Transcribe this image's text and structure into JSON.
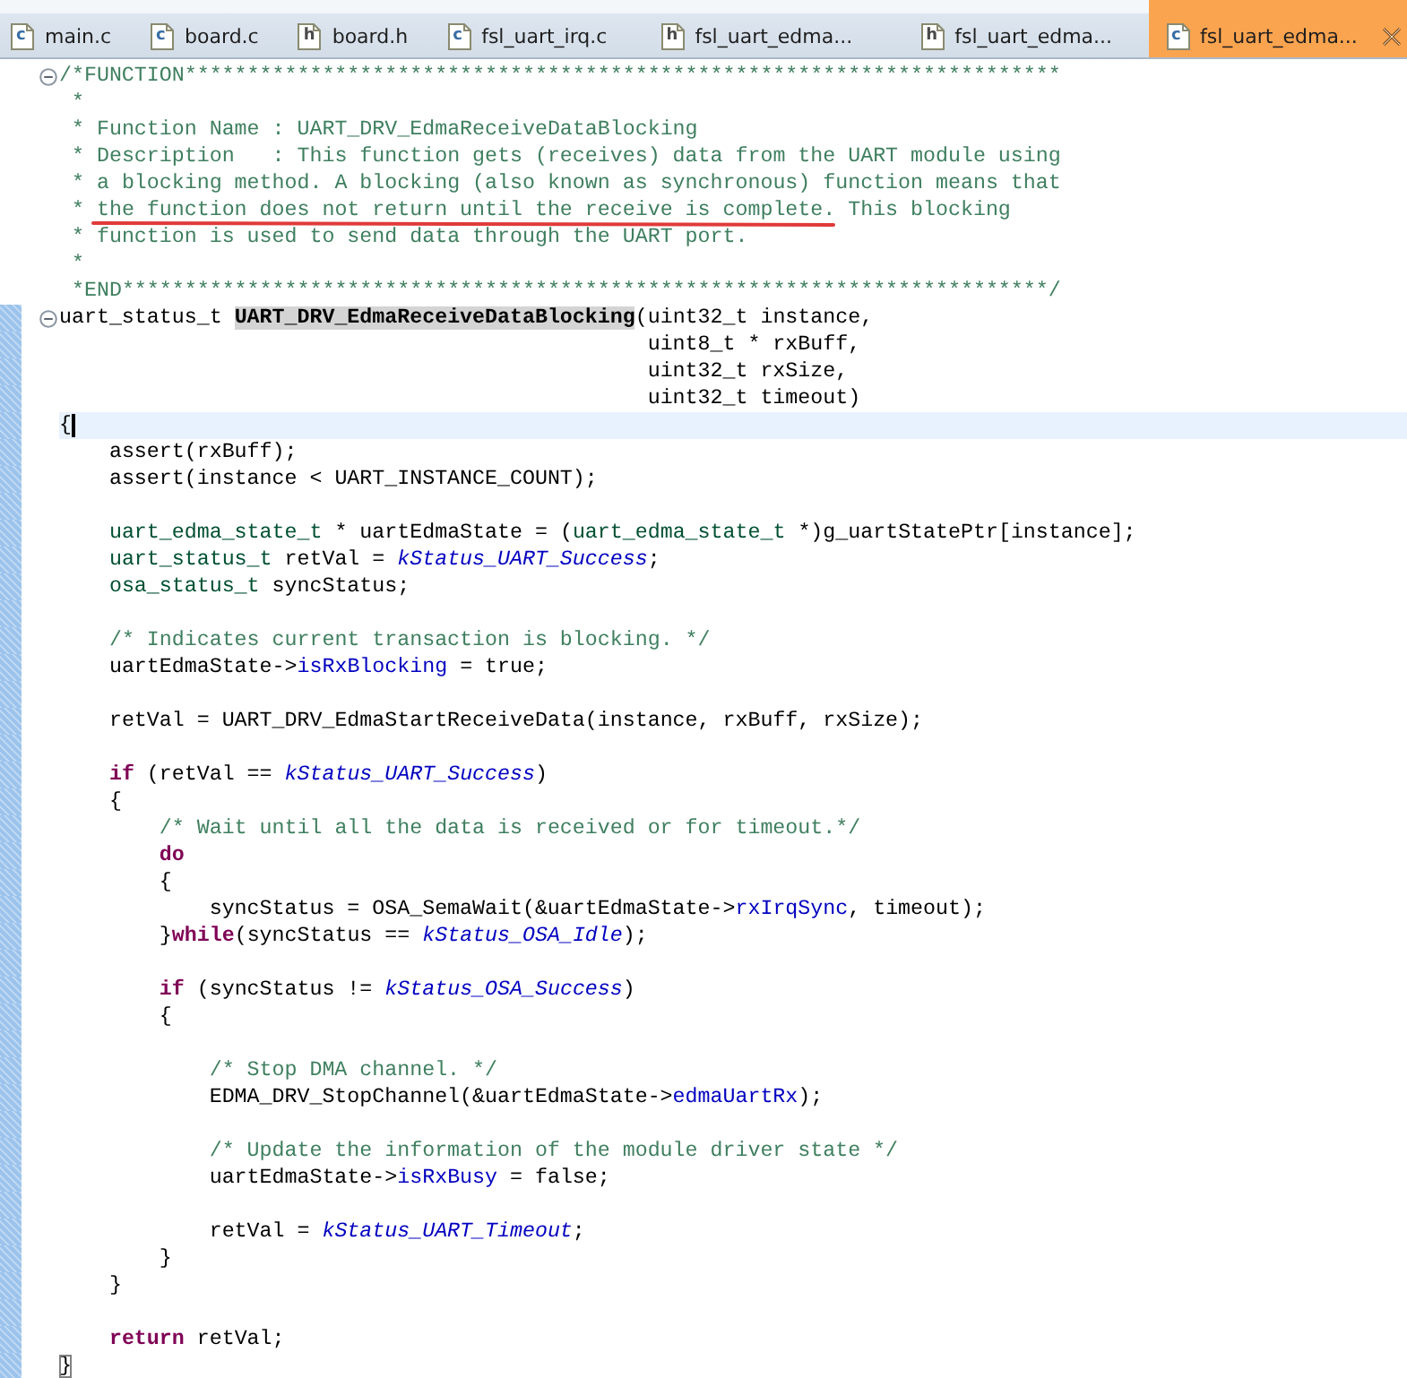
{
  "tabs": [
    {
      "label": "main.c",
      "file_type": "c",
      "selected": false,
      "closable": false
    },
    {
      "label": "board.c",
      "file_type": "c",
      "selected": false,
      "closable": false
    },
    {
      "label": "board.h",
      "file_type": "h",
      "selected": false,
      "closable": false
    },
    {
      "label": "fsl_uart_irq.c",
      "file_type": "c",
      "selected": false,
      "closable": false
    },
    {
      "label": "fsl_uart_edma...",
      "file_type": "h",
      "selected": false,
      "closable": false
    },
    {
      "label": "fsl_uart_edma...",
      "file_type": "h",
      "selected": false,
      "closable": false
    },
    {
      "label": "fsl_uart_edma...",
      "file_type": "c",
      "selected": true,
      "closable": true
    }
  ],
  "editor": {
    "lines": [
      {
        "fold": true,
        "changed": false,
        "current": false,
        "tokens": [
          {
            "kind": "comment",
            "text": "/*FUNCTION**********************************************************************"
          }
        ]
      },
      {
        "fold": false,
        "changed": false,
        "current": false,
        "tokens": [
          {
            "kind": "comment",
            "text": " *"
          }
        ]
      },
      {
        "fold": false,
        "changed": false,
        "current": false,
        "tokens": [
          {
            "kind": "comment",
            "text": " * Function Name : UART_DRV_EdmaReceiveDataBlocking"
          }
        ]
      },
      {
        "fold": false,
        "changed": false,
        "current": false,
        "tokens": [
          {
            "kind": "comment",
            "text": " * Description   : This function gets (receives) data from the UART module using"
          }
        ]
      },
      {
        "fold": false,
        "changed": false,
        "current": false,
        "tokens": [
          {
            "kind": "comment",
            "text": " * a blocking method. A blocking (also known as synchronous) function means that"
          }
        ]
      },
      {
        "fold": false,
        "changed": false,
        "current": false,
        "tokens": [
          {
            "kind": "comment",
            "text": " * the function does not return until the receive is complete. This blocking"
          }
        ]
      },
      {
        "fold": false,
        "changed": false,
        "current": false,
        "tokens": [
          {
            "kind": "comment",
            "text": " * function is used to send data through the UART port."
          }
        ]
      },
      {
        "fold": false,
        "changed": false,
        "current": false,
        "tokens": [
          {
            "kind": "comment",
            "text": " *"
          }
        ]
      },
      {
        "fold": false,
        "changed": false,
        "current": false,
        "tokens": [
          {
            "kind": "comment",
            "text": " *END**************************************************************************/"
          }
        ]
      },
      {
        "fold": true,
        "changed": true,
        "current": false,
        "tokens": [
          {
            "kind": "plain",
            "text": "uart_status_t "
          },
          {
            "kind": "declaration",
            "text": "UART_DRV_EdmaReceiveDataBlocking"
          },
          {
            "kind": "plain",
            "text": "(uint32_t instance,"
          }
        ]
      },
      {
        "fold": false,
        "changed": true,
        "current": false,
        "tokens": [
          {
            "kind": "plain",
            "text": "                                               uint8_t * rxBuff,"
          }
        ]
      },
      {
        "fold": false,
        "changed": true,
        "current": false,
        "tokens": [
          {
            "kind": "plain",
            "text": "                                               uint32_t rxSize,"
          }
        ]
      },
      {
        "fold": false,
        "changed": true,
        "current": false,
        "tokens": [
          {
            "kind": "plain",
            "text": "                                               uint32_t timeout)"
          }
        ]
      },
      {
        "fold": false,
        "changed": true,
        "current": true,
        "tokens": [
          {
            "kind": "plain",
            "text": "{"
          }
        ]
      },
      {
        "fold": false,
        "changed": true,
        "current": false,
        "tokens": [
          {
            "kind": "plain",
            "text": "    assert(rxBuff);"
          }
        ]
      },
      {
        "fold": false,
        "changed": true,
        "current": false,
        "tokens": [
          {
            "kind": "plain",
            "text": "    assert(instance < UART_INSTANCE_COUNT);"
          }
        ]
      },
      {
        "fold": false,
        "changed": true,
        "current": false
      },
      {
        "fold": false,
        "changed": true,
        "current": false,
        "tokens": [
          {
            "kind": "type",
            "text": "    uart_edma_state_t"
          },
          {
            "kind": "plain",
            "text": " * uartEdmaState = ("
          },
          {
            "kind": "type",
            "text": "uart_edma_state_t"
          },
          {
            "kind": "plain",
            "text": " *)g_uartStatePtr[instance];"
          }
        ]
      },
      {
        "fold": false,
        "changed": true,
        "current": false,
        "tokens": [
          {
            "kind": "type",
            "text": "    uart_status_t"
          },
          {
            "kind": "plain",
            "text": " retVal = "
          },
          {
            "kind": "constant",
            "text": "kStatus_UART_Success"
          },
          {
            "kind": "plain",
            "text": ";"
          }
        ]
      },
      {
        "fold": false,
        "changed": true,
        "current": false,
        "tokens": [
          {
            "kind": "type",
            "text": "    osa_status_t"
          },
          {
            "kind": "plain",
            "text": " syncStatus;"
          }
        ]
      },
      {
        "fold": false,
        "changed": true,
        "current": false
      },
      {
        "fold": false,
        "changed": true,
        "current": false,
        "tokens": [
          {
            "kind": "comment",
            "text": "    /* Indicates current transaction is blocking. */"
          }
        ]
      },
      {
        "fold": false,
        "changed": true,
        "current": false,
        "tokens": [
          {
            "kind": "plain",
            "text": "    uartEdmaState->"
          },
          {
            "kind": "field",
            "text": "isRxBlocking"
          },
          {
            "kind": "plain",
            "text": " = true;"
          }
        ]
      },
      {
        "fold": false,
        "changed": true,
        "current": false
      },
      {
        "fold": false,
        "changed": true,
        "current": false,
        "tokens": [
          {
            "kind": "plain",
            "text": "    retVal = UART_DRV_EdmaStartReceiveData(instance, rxBuff, rxSize);"
          }
        ]
      },
      {
        "fold": false,
        "changed": true,
        "current": false
      },
      {
        "fold": false,
        "changed": true,
        "current": false,
        "tokens": [
          {
            "kind": "keyword",
            "text": "    if"
          },
          {
            "kind": "plain",
            "text": " (retVal == "
          },
          {
            "kind": "constant",
            "text": "kStatus_UART_Success"
          },
          {
            "kind": "plain",
            "text": ")"
          }
        ]
      },
      {
        "fold": false,
        "changed": true,
        "current": false,
        "tokens": [
          {
            "kind": "plain",
            "text": "    {"
          }
        ]
      },
      {
        "fold": false,
        "changed": true,
        "current": false,
        "tokens": [
          {
            "kind": "comment",
            "text": "        /* Wait until all the data is received or for timeout.*/"
          }
        ]
      },
      {
        "fold": false,
        "changed": true,
        "current": false,
        "tokens": [
          {
            "kind": "keyword",
            "text": "        do"
          }
        ]
      },
      {
        "fold": false,
        "changed": true,
        "current": false,
        "tokens": [
          {
            "kind": "plain",
            "text": "        {"
          }
        ]
      },
      {
        "fold": false,
        "changed": true,
        "current": false,
        "tokens": [
          {
            "kind": "plain",
            "text": "            syncStatus = OSA_SemaWait(&uartEdmaState->"
          },
          {
            "kind": "field",
            "text": "rxIrqSync"
          },
          {
            "kind": "plain",
            "text": ", timeout);"
          }
        ]
      },
      {
        "fold": false,
        "changed": true,
        "current": false,
        "tokens": [
          {
            "kind": "plain",
            "text": "        }"
          },
          {
            "kind": "keyword",
            "text": "while"
          },
          {
            "kind": "plain",
            "text": "(syncStatus == "
          },
          {
            "kind": "constant",
            "text": "kStatus_OSA_Idle"
          },
          {
            "kind": "plain",
            "text": ");"
          }
        ]
      },
      {
        "fold": false,
        "changed": true,
        "current": false
      },
      {
        "fold": false,
        "changed": true,
        "current": false,
        "tokens": [
          {
            "kind": "keyword",
            "text": "        if"
          },
          {
            "kind": "plain",
            "text": " (syncStatus != "
          },
          {
            "kind": "constant",
            "text": "kStatus_OSA_Success"
          },
          {
            "kind": "plain",
            "text": ")"
          }
        ]
      },
      {
        "fold": false,
        "changed": true,
        "current": false,
        "tokens": [
          {
            "kind": "plain",
            "text": "        {"
          }
        ]
      },
      {
        "fold": false,
        "changed": true,
        "current": false
      },
      {
        "fold": false,
        "changed": true,
        "current": false,
        "tokens": [
          {
            "kind": "comment",
            "text": "            /* Stop DMA channel. */"
          }
        ]
      },
      {
        "fold": false,
        "changed": true,
        "current": false,
        "tokens": [
          {
            "kind": "plain",
            "text": "            EDMA_DRV_StopChannel(&uartEdmaState->"
          },
          {
            "kind": "field",
            "text": "edmaUartRx"
          },
          {
            "kind": "plain",
            "text": ");"
          }
        ]
      },
      {
        "fold": false,
        "changed": true,
        "current": false
      },
      {
        "fold": false,
        "changed": true,
        "current": false,
        "tokens": [
          {
            "kind": "comment",
            "text": "            /* Update the information of the module driver state */"
          }
        ]
      },
      {
        "fold": false,
        "changed": true,
        "current": false,
        "tokens": [
          {
            "kind": "plain",
            "text": "            uartEdmaState->"
          },
          {
            "kind": "field",
            "text": "isRxBusy"
          },
          {
            "kind": "plain",
            "text": " = false;"
          }
        ]
      },
      {
        "fold": false,
        "changed": true,
        "current": false
      },
      {
        "fold": false,
        "changed": true,
        "current": false,
        "tokens": [
          {
            "kind": "plain",
            "text": "            retVal = "
          },
          {
            "kind": "constant",
            "text": "kStatus_UART_Timeout"
          },
          {
            "kind": "plain",
            "text": ";"
          }
        ]
      },
      {
        "fold": false,
        "changed": true,
        "current": false,
        "tokens": [
          {
            "kind": "plain",
            "text": "        }"
          }
        ]
      },
      {
        "fold": false,
        "changed": true,
        "current": false,
        "tokens": [
          {
            "kind": "plain",
            "text": "    }"
          }
        ]
      },
      {
        "fold": false,
        "changed": true,
        "current": false
      },
      {
        "fold": false,
        "changed": true,
        "current": false,
        "tokens": [
          {
            "kind": "keyword",
            "text": "    return"
          },
          {
            "kind": "plain",
            "text": " retVal;"
          }
        ]
      },
      {
        "fold": false,
        "changed": true,
        "current": false,
        "tokens": [
          {
            "kind": "matched_bracket",
            "text": "}"
          }
        ]
      }
    ]
  }
}
